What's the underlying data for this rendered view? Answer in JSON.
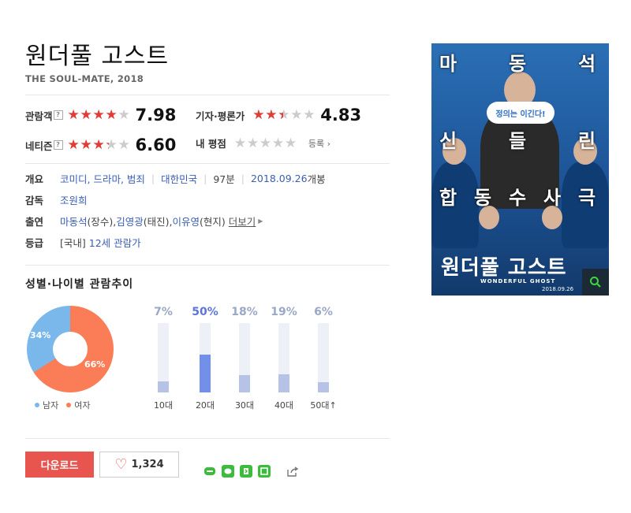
{
  "movie": {
    "title": "원더풀 고스트",
    "subtitle": "THE SOUL-MATE, 2018"
  },
  "ratings": {
    "audience": {
      "label": "관람객",
      "help": "?",
      "score": "7.98",
      "stars": 3.99
    },
    "critics": {
      "label": "기자·평론가",
      "score": "4.83",
      "stars": 2.42
    },
    "netizen": {
      "label": "네티즌",
      "help": "?",
      "score": "6.60",
      "stars": 3.3
    },
    "my": {
      "label": "내 평점",
      "register": "등록",
      "stars": 0
    }
  },
  "info": {
    "overview_label": "개요",
    "genres": "코미디, 드라마, 범죄",
    "country": "대한민국",
    "runtime": "97분",
    "release_date": "2018.09.26",
    "release_suffix": "개봉",
    "director_label": "감독",
    "director": "조원희",
    "cast_label": "출연",
    "cast": [
      "마동석",
      "김영광",
      "이유영"
    ],
    "cast_roles": [
      "(장수), ",
      "(태진), ",
      "(현지)"
    ],
    "more": "더보기",
    "grade_label": "등급",
    "grade_prefix": "[국내]",
    "grade": "12세 관람가"
  },
  "demographics": {
    "title": "성별·나이별 관람추이",
    "gender": [
      {
        "label": "남자",
        "percent": 34,
        "percent_text": "34%",
        "color": "#7ab8ec"
      },
      {
        "label": "여자",
        "percent": 66,
        "percent_text": "66%",
        "color": "#fa7d57"
      }
    ],
    "age": [
      {
        "label": "10대",
        "value": 7,
        "text": "7%",
        "highlight": false
      },
      {
        "label": "20대",
        "value": 50,
        "text": "50%",
        "highlight": true
      },
      {
        "label": "30대",
        "value": 18,
        "text": "18%",
        "highlight": false
      },
      {
        "label": "40대",
        "value": 19,
        "text": "19%",
        "highlight": false
      },
      {
        "label": "50대",
        "value": 6,
        "text": "6%",
        "highlight": false,
        "suffix": "↑"
      }
    ]
  },
  "actions": {
    "download": "다운로드",
    "likes": "1,324"
  },
  "poster": {
    "top_chars": [
      "마",
      "동",
      "석"
    ],
    "mid_chars": [
      "신",
      "들",
      "린"
    ],
    "low_chars": [
      "합",
      "동",
      "수",
      "사",
      "극"
    ],
    "bubble": "정의는 이긴다!",
    "title": "원더풀 고스트",
    "en_title": "WONDERFUL GHOST",
    "date": "2018.09.26"
  },
  "colors": {
    "accent_red": "#e43b36",
    "link": "#3a5eb5",
    "download_btn": "#e8544e"
  }
}
